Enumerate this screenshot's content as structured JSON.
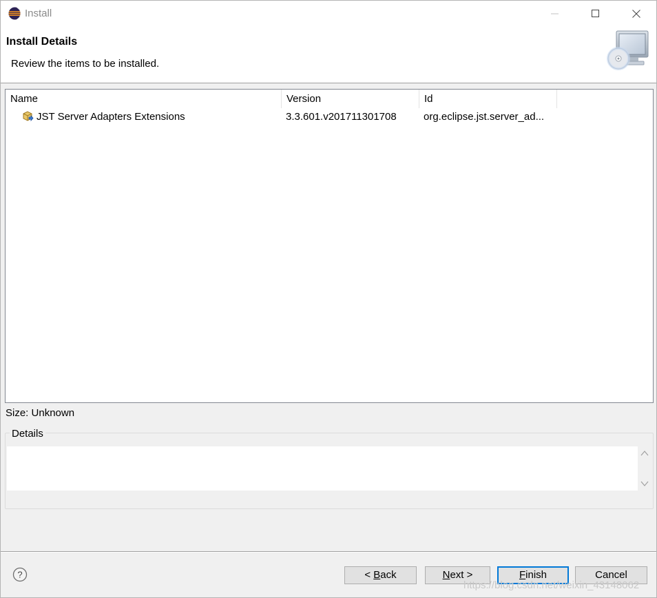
{
  "window": {
    "title": "Install",
    "colors": {
      "accent": "#0078d7",
      "header_bg": "#ffffff",
      "dialog_bg": "#f0f0f0"
    }
  },
  "header": {
    "title": "Install Details",
    "description": "Review the items to be installed."
  },
  "table": {
    "columns": [
      "Name",
      "Version",
      "Id"
    ],
    "rows": [
      {
        "name": "JST Server Adapters Extensions",
        "version": "3.3.601.v201711301708",
        "id": "org.eclipse.jst.server_ad..."
      }
    ]
  },
  "size_label": "Size: Unknown",
  "details": {
    "legend": "Details",
    "text": ""
  },
  "buttons": {
    "back": {
      "prefix": "< ",
      "mnemonic": "B",
      "rest": "ack"
    },
    "next": {
      "mnemonic": "N",
      "rest": "ext >"
    },
    "finish": {
      "mnemonic": "F",
      "rest": "inish"
    },
    "cancel": "Cancel"
  },
  "watermark": "https://blog.csdn.net/weixin_43148062",
  "icons": {
    "app": "eclipse-icon",
    "banner": "install-computer-cd-icon",
    "row": "feature-plugin-icon",
    "help": "help-question-icon"
  }
}
